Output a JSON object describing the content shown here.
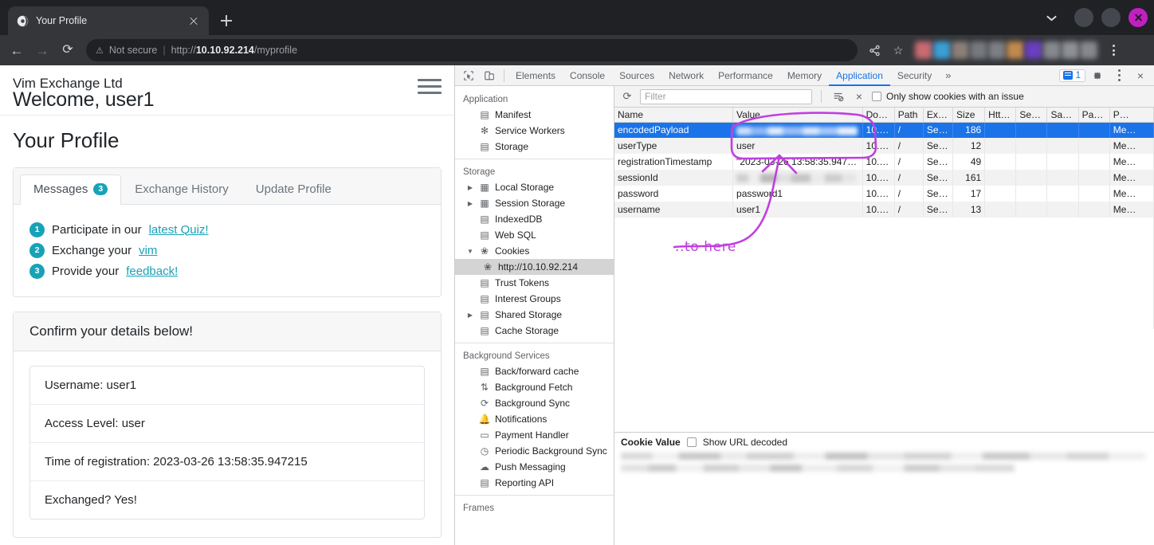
{
  "browser": {
    "tab": {
      "title": "Your Profile",
      "favicon": "globe-icon",
      "close": "×"
    },
    "newtab_label": "+",
    "window_controls": {
      "minimize": "minimize-dot",
      "maximize": "maximize-dot",
      "close": "×"
    },
    "omnibox": {
      "back": "←",
      "forward": "→",
      "reload": "⟳",
      "warning_icon": "⚠",
      "security_label": "Not secure",
      "separator": "|",
      "url_scheme": "http://",
      "url_host": "10.10.92.214",
      "url_path": "/myprofile",
      "share_icon": "share-icon",
      "bookmark_icon": "☆",
      "menu_icon": "kebab-menu-icon"
    }
  },
  "page": {
    "brand": "Vim Exchange Ltd",
    "welcome": "Welcome, user1",
    "heading": "Your Profile",
    "tabs": [
      {
        "label": "Messages",
        "badge": "3",
        "active": true
      },
      {
        "label": "Exchange History",
        "badge": "",
        "active": false
      },
      {
        "label": "Update Profile",
        "badge": "",
        "active": false
      }
    ],
    "messages": [
      {
        "num": "1",
        "pre": "Participate in our ",
        "link": "latest Quiz!",
        "post": ""
      },
      {
        "num": "2",
        "pre": "Exchange your ",
        "link": "vim",
        "post": ""
      },
      {
        "num": "3",
        "pre": "Provide your ",
        "link": "feedback!",
        "post": ""
      }
    ],
    "details_header": "Confirm your details below!",
    "details": [
      "Username:  user1",
      "Access Level:  user",
      "Time of registration: 2023-03-26 13:58:35.947215",
      "Exchanged? Yes!"
    ],
    "accent_color": "#17a2b8"
  },
  "devtools": {
    "toolbar": {
      "inspect_icon": "inspect-element-icon",
      "device_icon": "device-toolbar-icon",
      "tabs": [
        {
          "label": "Elements",
          "active": false
        },
        {
          "label": "Console",
          "active": false
        },
        {
          "label": "Sources",
          "active": false
        },
        {
          "label": "Network",
          "active": false
        },
        {
          "label": "Performance",
          "active": false
        },
        {
          "label": "Memory",
          "active": false
        },
        {
          "label": "Application",
          "active": true
        },
        {
          "label": "Security",
          "active": false
        }
      ],
      "more_label": "»",
      "issues_count": "1",
      "settings_icon": "gear-icon",
      "menu_icon": "kebab-menu-icon",
      "close_icon": "×"
    },
    "sidebar": {
      "groups": [
        {
          "title": "Application",
          "items": [
            {
              "label": "Manifest",
              "icon": "document-icon",
              "indent": 1,
              "twisty": "",
              "selected": false
            },
            {
              "label": "Service Workers",
              "icon": "gear-icon",
              "indent": 1,
              "twisty": "",
              "selected": false
            },
            {
              "label": "Storage",
              "icon": "database-icon",
              "indent": 1,
              "twisty": "",
              "selected": false
            }
          ]
        },
        {
          "title": "Storage",
          "items": [
            {
              "label": "Local Storage",
              "icon": "table-icon",
              "indent": 1,
              "twisty": "▶",
              "selected": false
            },
            {
              "label": "Session Storage",
              "icon": "table-icon",
              "indent": 1,
              "twisty": "▶",
              "selected": false
            },
            {
              "label": "IndexedDB",
              "icon": "database-icon",
              "indent": 1,
              "twisty": "",
              "selected": false
            },
            {
              "label": "Web SQL",
              "icon": "database-icon",
              "indent": 1,
              "twisty": "",
              "selected": false
            },
            {
              "label": "Cookies",
              "icon": "cookie-icon",
              "indent": 1,
              "twisty": "▼",
              "selected": false
            },
            {
              "label": "http://10.10.92.214",
              "icon": "cookie-icon",
              "indent": 2,
              "twisty": "",
              "selected": true
            },
            {
              "label": "Trust Tokens",
              "icon": "database-icon",
              "indent": 1,
              "twisty": "",
              "selected": false
            },
            {
              "label": "Interest Groups",
              "icon": "database-icon",
              "indent": 1,
              "twisty": "",
              "selected": false
            },
            {
              "label": "Shared Storage",
              "icon": "database-icon",
              "indent": 1,
              "twisty": "▶",
              "selected": false
            },
            {
              "label": "Cache Storage",
              "icon": "database-icon",
              "indent": 1,
              "twisty": "",
              "selected": false
            }
          ]
        },
        {
          "title": "Background Services",
          "items": [
            {
              "label": "Back/forward cache",
              "icon": "database-icon",
              "indent": 1,
              "twisty": "",
              "selected": false
            },
            {
              "label": "Background Fetch",
              "icon": "updown-arrow-icon",
              "indent": 1,
              "twisty": "",
              "selected": false
            },
            {
              "label": "Background Sync",
              "icon": "sync-icon",
              "indent": 1,
              "twisty": "",
              "selected": false
            },
            {
              "label": "Notifications",
              "icon": "bell-icon",
              "indent": 1,
              "twisty": "",
              "selected": false
            },
            {
              "label": "Payment Handler",
              "icon": "credit-card-icon",
              "indent": 1,
              "twisty": "",
              "selected": false
            },
            {
              "label": "Periodic Background Sync",
              "icon": "clock-icon",
              "indent": 1,
              "twisty": "",
              "selected": false
            },
            {
              "label": "Push Messaging",
              "icon": "cloud-icon",
              "indent": 1,
              "twisty": "",
              "selected": false
            },
            {
              "label": "Reporting API",
              "icon": "document-icon",
              "indent": 1,
              "twisty": "",
              "selected": false
            }
          ]
        },
        {
          "title": "Frames",
          "items": []
        }
      ]
    },
    "cookies_toolbar": {
      "refresh_icon": "refresh-icon",
      "filter_placeholder": "Filter",
      "filter_value": "",
      "clear_filter_icon": "clear-filter-icon",
      "clear_all_icon": "×",
      "only_issues_label": "Only show cookies with an issue",
      "only_issues_checked": false
    },
    "cookies_table": {
      "columns": [
        "Name",
        "Value",
        "Do…",
        "Path",
        "Ex…",
        "Size",
        "Htt…",
        "Se…",
        "Sa…",
        "Pa…",
        "P…"
      ],
      "rows": [
        {
          "name": "encodedPayload",
          "value": "",
          "value_blurred": true,
          "domain": "10.…",
          "path": "/",
          "expires": "Se…",
          "size": "186",
          "httponly": "",
          "secure": "",
          "samesite": "",
          "partition": "",
          "priority": "Me…",
          "selected": true
        },
        {
          "name": "userType",
          "value": "user",
          "value_blurred": false,
          "domain": "10.…",
          "path": "/",
          "expires": "Se…",
          "size": "12",
          "httponly": "",
          "secure": "",
          "samesite": "",
          "partition": "",
          "priority": "Me…",
          "selected": false
        },
        {
          "name": "registrationTimestamp",
          "value": "\"2023-03-26 13:58:35.947…",
          "value_blurred": false,
          "domain": "10.…",
          "path": "/",
          "expires": "Se…",
          "size": "49",
          "httponly": "",
          "secure": "",
          "samesite": "",
          "partition": "",
          "priority": "Me…",
          "selected": false
        },
        {
          "name": "sessionId",
          "value": "",
          "value_blurred": true,
          "domain": "10.…",
          "path": "/",
          "expires": "Se…",
          "size": "161",
          "httponly": "",
          "secure": "",
          "samesite": "",
          "partition": "",
          "priority": "Me…",
          "selected": false
        },
        {
          "name": "password",
          "value": "password1",
          "value_blurred": false,
          "domain": "10.…",
          "path": "/",
          "expires": "Se…",
          "size": "17",
          "httponly": "",
          "secure": "",
          "samesite": "",
          "partition": "",
          "priority": "Me…",
          "selected": false
        },
        {
          "name": "username",
          "value": "user1",
          "value_blurred": false,
          "domain": "10.…",
          "path": "/",
          "expires": "Se…",
          "size": "13",
          "httponly": "",
          "secure": "",
          "samesite": "",
          "partition": "",
          "priority": "Me…",
          "selected": false
        }
      ]
    },
    "cookie_value_panel": {
      "title": "Cookie Value",
      "show_url_decoded_label": "Show URL decoded",
      "show_url_decoded_checked": false,
      "value_blurred": true
    }
  },
  "annotation": {
    "text": "..to here",
    "color": "#bf3fe0"
  }
}
